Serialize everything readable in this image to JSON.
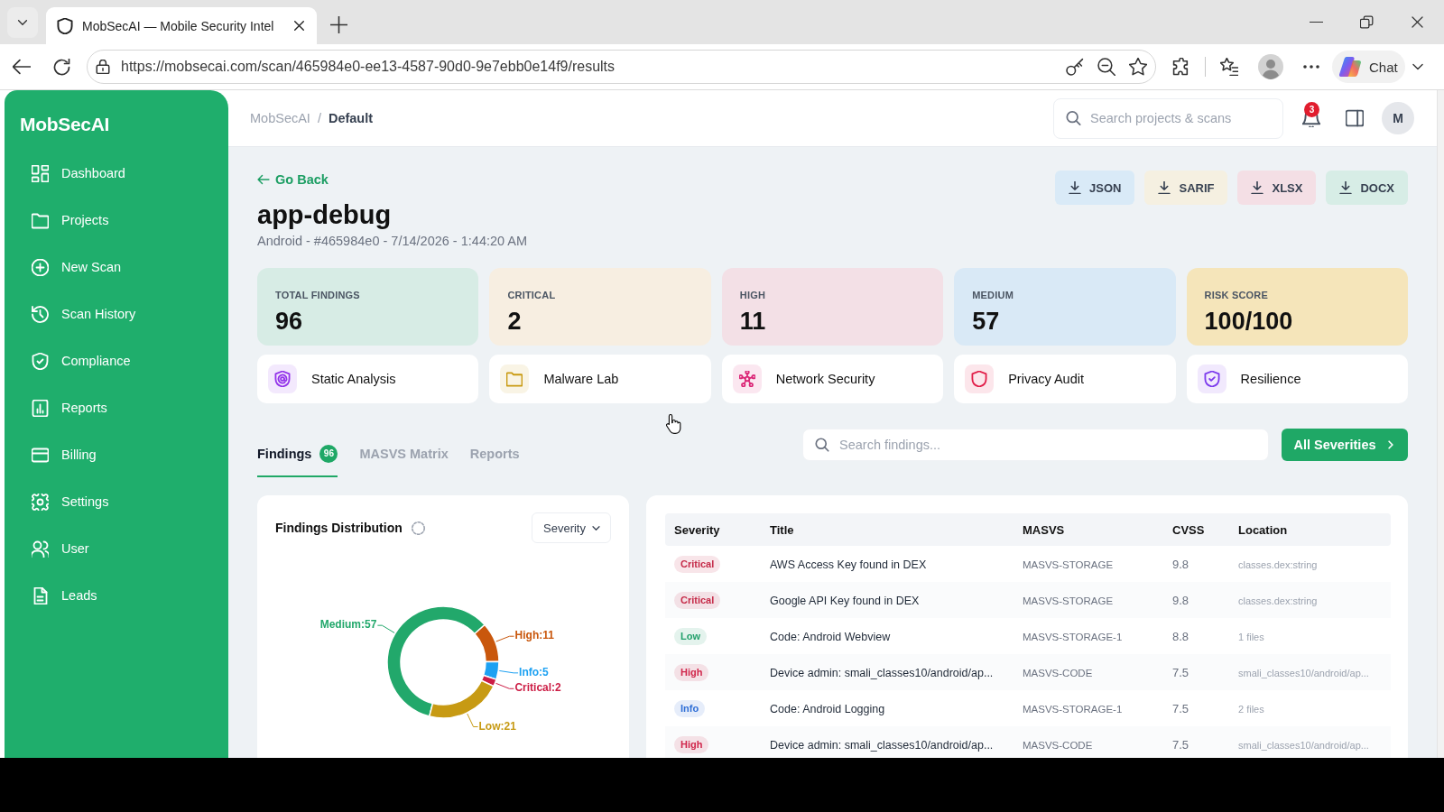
{
  "browser": {
    "tab_title": "MobSecAI — Mobile Security Intel",
    "url": "https://mobsecai.com/scan/465984e0-ee13-4587-90d0-9e7ebb0e14f9/results",
    "chat_label": "Chat"
  },
  "sidebar": {
    "logo": "MobSecAI",
    "items": [
      {
        "label": "Dashboard",
        "selected": false
      },
      {
        "label": "Projects",
        "selected": false
      },
      {
        "label": "New Scan",
        "selected": false
      },
      {
        "label": "Scan History",
        "selected": false
      },
      {
        "label": "Compliance",
        "selected": false
      },
      {
        "label": "Reports",
        "selected": false
      },
      {
        "label": "Billing",
        "selected": false
      },
      {
        "label": "Settings",
        "selected": false
      },
      {
        "label": "User",
        "selected": false
      },
      {
        "label": "Leads",
        "selected": false
      }
    ]
  },
  "header": {
    "breadcrumb": {
      "parent": "MobSecAI",
      "separator": "/",
      "current": "Default"
    },
    "search": {
      "placeholder": "Search projects & scans"
    },
    "notifications": "3",
    "avatar": "M"
  },
  "scan": {
    "back_label": "Go Back",
    "title": "app-debug",
    "subtitle": "Android - #465984e0 - 7/14/2026 - 1:44:20 AM"
  },
  "exports": [
    {
      "label": "JSON",
      "color": "#d9eaf7"
    },
    {
      "label": "SARIF",
      "color": "#f5f0e1"
    },
    {
      "label": "XLSX",
      "color": "#f4dfe5"
    },
    {
      "label": "DOCX",
      "color": "#d7ede6"
    }
  ],
  "stats": [
    {
      "label": "TOTAL FINDINGS",
      "value": "96",
      "color": "#d7ece5"
    },
    {
      "label": "CRITICAL",
      "value": "2",
      "color": "#f7eee1"
    },
    {
      "label": "HIGH",
      "value": "11",
      "color": "#f3e0e6"
    },
    {
      "label": "MEDIUM",
      "value": "57",
      "color": "#d9e9f6"
    },
    {
      "label": "RISK SCORE",
      "value": "100/100",
      "color": "#f5e5ba"
    }
  ],
  "modules": [
    {
      "label": "Static Analysis",
      "color": "#9333ea"
    },
    {
      "label": "Malware Lab",
      "color": "#c99a12"
    },
    {
      "label": "Network Security",
      "color": "#db2777"
    },
    {
      "label": "Privacy Audit",
      "color": "#e11d48"
    },
    {
      "label": "Resilience",
      "color": "#7c3aed"
    }
  ],
  "tabs": [
    {
      "label": "Findings",
      "badge": "96",
      "selected": true
    },
    {
      "label": "MASVS Matrix",
      "selected": false
    },
    {
      "label": "Reports",
      "selected": false
    }
  ],
  "findings_search": {
    "placeholder": "Search findings..."
  },
  "severity_filter": {
    "label": "All Severities"
  },
  "distribution": {
    "group_by": "Severity",
    "chart_data": {
      "type": "donut",
      "title": "Findings Distribution",
      "values": [
        57,
        11,
        5,
        2,
        21
      ],
      "value_labels": [
        "Medium:57",
        "High:11",
        "Info:5",
        "Critical:2",
        "Low:21"
      ]
    }
  },
  "table": {
    "columns": [
      "Severity",
      "Title",
      "MASVS",
      "CVSS",
      "Location"
    ],
    "rows": [
      {
        "severity": "Critical",
        "color": "#c52a48",
        "title": "AWS Access Key found in DEX",
        "masvs": "MASVS-STORAGE",
        "cvss": "9.8",
        "location": "classes.dex:string"
      },
      {
        "severity": "Critical",
        "color": "#c52a48",
        "title": "Google API Key found in DEX",
        "masvs": "MASVS-STORAGE",
        "cvss": "9.8",
        "location": "classes.dex:string"
      },
      {
        "severity": "Low",
        "color": "#22a06b",
        "title": "Code: Android Webview",
        "masvs": "MASVS-STORAGE-1",
        "cvss": "8.8",
        "location": "1 files"
      },
      {
        "severity": "High",
        "color": "#d0264b",
        "title": "Device admin: smali_classes10/android/ap...",
        "masvs": "MASVS-CODE",
        "cvss": "7.5",
        "location": "smali_classes10/android/ap..."
      },
      {
        "severity": "Info",
        "color": "#2f6fd6",
        "title": "Code: Android Logging",
        "masvs": "MASVS-STORAGE-1",
        "cvss": "7.5",
        "location": "2 files"
      },
      {
        "severity": "High",
        "color": "#d0264b",
        "title": "Device admin: smali_classes10/android/ap...",
        "masvs": "MASVS-CODE",
        "cvss": "7.5",
        "location": "smali_classes10/android/ap..."
      }
    ]
  }
}
